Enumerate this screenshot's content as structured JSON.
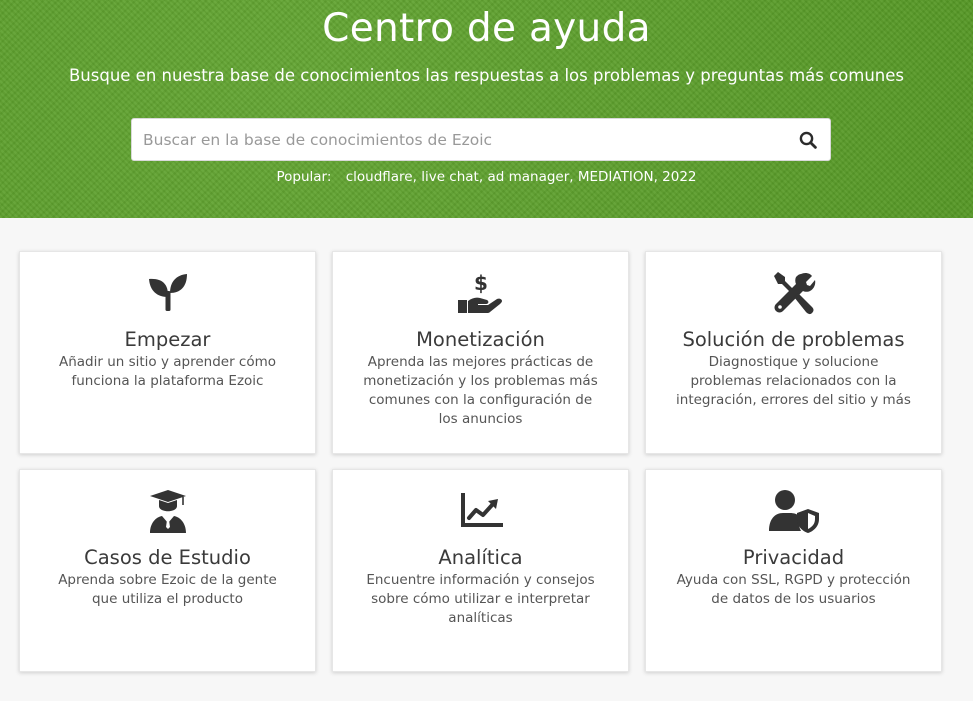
{
  "hero": {
    "title": "Centro de ayuda",
    "subtitle": "Busque en nuestra base de conocimientos las respuestas a los problemas y preguntas más comunes",
    "search_placeholder": "Buscar en la base de conocimientos de Ezoic",
    "search_icon": "search-icon",
    "popular_label": "Popular:",
    "popular_links": [
      "cloudflare",
      "live chat",
      "ad manager",
      "MEDIATION",
      "2022"
    ]
  },
  "colors": {
    "hero_green": "#5aa027",
    "icon_dark": "#333333",
    "card_bg": "#ffffff",
    "page_bg": "#f7f7f7"
  },
  "cards": [
    {
      "icon": "seedling-icon",
      "title": "Empezar",
      "description": "Añadir un sitio y aprender cómo funciona la plataforma Ezoic"
    },
    {
      "icon": "hand-dollar-icon",
      "title": "Monetización",
      "description": "Aprenda las mejores prácticas de monetización y los problemas más comunes con la configuración de los anuncios"
    },
    {
      "icon": "tools-icon",
      "title": "Solución de problemas",
      "description": "Diagnostique y solucione problemas relacionados con la integración, errores del sitio y más"
    },
    {
      "icon": "graduate-icon",
      "title": "Casos de Estudio",
      "description": "Aprenda sobre Ezoic de la gente que utiliza el producto"
    },
    {
      "icon": "chart-trend-icon",
      "title": "Analítica",
      "description": "Encuentre información y consejos sobre cómo utilizar e interpretar analíticas"
    },
    {
      "icon": "user-shield-icon",
      "title": "Privacidad",
      "description": "Ayuda con SSL, RGPD y protección de datos de los usuarios"
    }
  ]
}
